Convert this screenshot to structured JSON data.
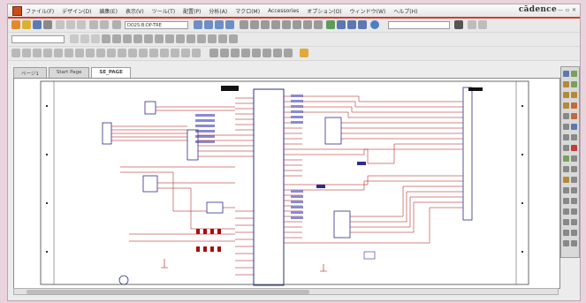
{
  "menu": {
    "items": [
      "ファイル(F)",
      "デザイン(D)",
      "編集(E)",
      "表示(V)",
      "ツール(T)",
      "配置(P)",
      "分析(A)",
      "マクロ(M)",
      "Accessories",
      "オプション(O)",
      "ウィンドウ(W)",
      "ヘルプ(H)"
    ]
  },
  "brand": {
    "name": "cādence"
  },
  "toolbar": {
    "zoom_combo": "DO2S:B:DP-TRE",
    "right_combo": ""
  },
  "tabs": [
    {
      "label": "ページ1"
    },
    {
      "label": "Start Page"
    },
    {
      "label": "SE_PAGE"
    }
  ],
  "colors": {
    "accent": "#d63b2a",
    "wire": "#a80d0d",
    "part": "#2d2d8a",
    "frame": "#e9d3dc"
  },
  "icons": {
    "app": "capture-app-icon",
    "window_controls": [
      "minimize-icon",
      "restore-icon",
      "close-icon"
    ]
  }
}
